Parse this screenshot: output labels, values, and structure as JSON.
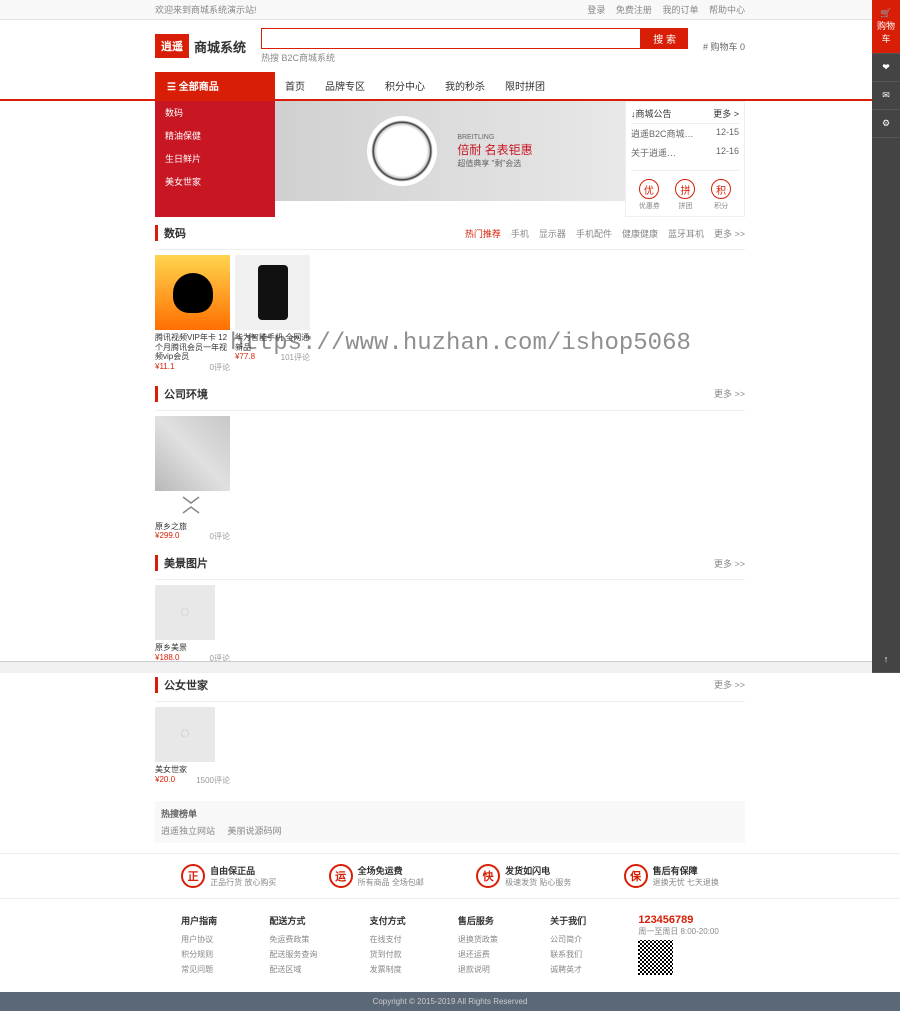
{
  "topbar": {
    "welcome": "欢迎来到商城系统演示站!",
    "links": [
      "登录",
      "免费注册",
      "我的订单",
      "帮助中心"
    ]
  },
  "header": {
    "logo_badge": "逍遥",
    "logo_text": "商城系统",
    "search_placeholder": "",
    "search_btn": "搜 索",
    "hot_words": "热搜 B2C商城系统",
    "cart": "# 购物车 0"
  },
  "nav": {
    "cat_title": "☰ 全部商品",
    "links": [
      "首页",
      "品牌专区",
      "积分中心",
      "我的秒杀",
      "限时拼团"
    ]
  },
  "sidebar": {
    "items": [
      "数码",
      "精油保健",
      "生日鲜片",
      "美女世家"
    ]
  },
  "banner": {
    "brand_label": "BREITLING",
    "headline": "倍耐 名表钜惠",
    "subhead": "超值典享 \"剩\"会选"
  },
  "news": {
    "title": "↓商城公告",
    "more": "更多 >",
    "items": [
      {
        "t": "逍遥B2C商城…",
        "d": "12-15"
      },
      {
        "t": "关于逍遥…",
        "d": "12-16"
      }
    ],
    "icons": [
      "优",
      "拼",
      "积"
    ],
    "icon_labels": [
      "优惠券",
      "拼团",
      "积分"
    ]
  },
  "sections": [
    {
      "title": "数码",
      "tabs": [
        "热门推荐",
        "手机",
        "显示器",
        "手机配件",
        "健康健康",
        "蓝牙耳机"
      ],
      "active_tab": 0,
      "more": "更多 >>",
      "products": [
        {
          "name": "腾讯视频VIP年卡 12个月腾讯会员一年视频vip会员",
          "price": "¥11.1",
          "eval": "0评论"
        },
        {
          "name": "华为智能手机 全网通 新品",
          "price": "¥77.8",
          "eval": "101评论"
        }
      ]
    },
    {
      "title": "公司环境",
      "more": "更多 >>",
      "products": [
        {
          "name": "原乡之旅",
          "price": "¥299.0",
          "eval": "0评论"
        }
      ]
    },
    {
      "title": "美景图片",
      "more": "更多 >>",
      "products": [
        {
          "name": "原乡美景",
          "price": "¥188.0",
          "eval": "0评论"
        }
      ]
    },
    {
      "title": "公女世家",
      "more": "更多 >>",
      "products": [
        {
          "name": "美女世家",
          "price": "¥20.0",
          "eval": "1500评论"
        }
      ]
    }
  ],
  "hot_search": {
    "title": "热搜榜单",
    "items": [
      "逍遥独立网站",
      "美丽说源码网"
    ]
  },
  "services": [
    {
      "icon": "正",
      "title": "自由保正品",
      "desc": "正品行货 放心购买"
    },
    {
      "icon": "运",
      "title": "全场免运费",
      "desc": "所有商品 全场包邮"
    },
    {
      "icon": "快",
      "title": "发货如闪电",
      "desc": "极速发货 贴心服务"
    },
    {
      "icon": "保",
      "title": "售后有保障",
      "desc": "退换无忧 七天退换"
    }
  ],
  "footer": {
    "cols": [
      {
        "title": "用户指南",
        "items": [
          "用户协议",
          "积分规则",
          "常见问题"
        ]
      },
      {
        "title": "配送方式",
        "items": [
          "免运费政策",
          "配送服务查询",
          "配送区域"
        ]
      },
      {
        "title": "支付方式",
        "items": [
          "在线支付",
          "货到付款",
          "发票制度"
        ]
      },
      {
        "title": "售后服务",
        "items": [
          "退换货政策",
          "退还运费",
          "退款说明"
        ]
      },
      {
        "title": "关于我们",
        "items": [
          "公司简介",
          "联系我们",
          "诚聘英才"
        ]
      }
    ],
    "phone": "123456789",
    "hours": "周一至周日 8:00-20:00"
  },
  "copyright": "Copyright © 2015-2019 All Rights Reserved",
  "right_sidebar": [
    "🛒 购物车",
    "❤",
    "✉",
    "⚙",
    "↑"
  ],
  "watermark": "https://www.huzhan.com/ishop5068"
}
